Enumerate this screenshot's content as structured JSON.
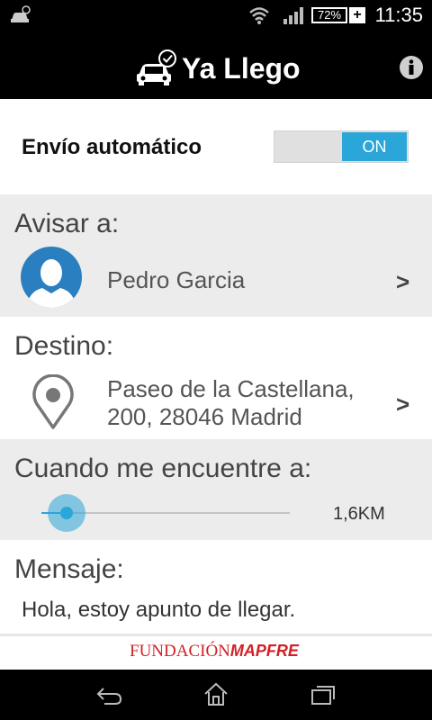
{
  "status_bar": {
    "battery": "72%",
    "battery_plus": "+",
    "time": "11:35"
  },
  "app_bar": {
    "title": "Ya Llego"
  },
  "auto_send": {
    "label": "Envío automático",
    "toggle_label": "ON"
  },
  "notify": {
    "heading": "Avisar a:",
    "contact": "Pedro Garcia",
    "arrow": ">"
  },
  "destination": {
    "heading": "Destino:",
    "line1": "Paseo de la Castellana,",
    "line2": "200, 28046 Madrid",
    "arrow": ">"
  },
  "distance": {
    "heading": "Cuando me encuentre a:",
    "value_label": "1,6KM",
    "value_fraction": 0.1
  },
  "message": {
    "heading": "Mensaje:",
    "text": "Hola, estoy apunto de llegar."
  },
  "footer": {
    "logo_part1": "FUNDACIÓN",
    "logo_part2": "MAPFRE"
  },
  "colors": {
    "accent": "#2aa6d9",
    "section_grey": "#ececec",
    "brand_red": "#d21f26"
  }
}
